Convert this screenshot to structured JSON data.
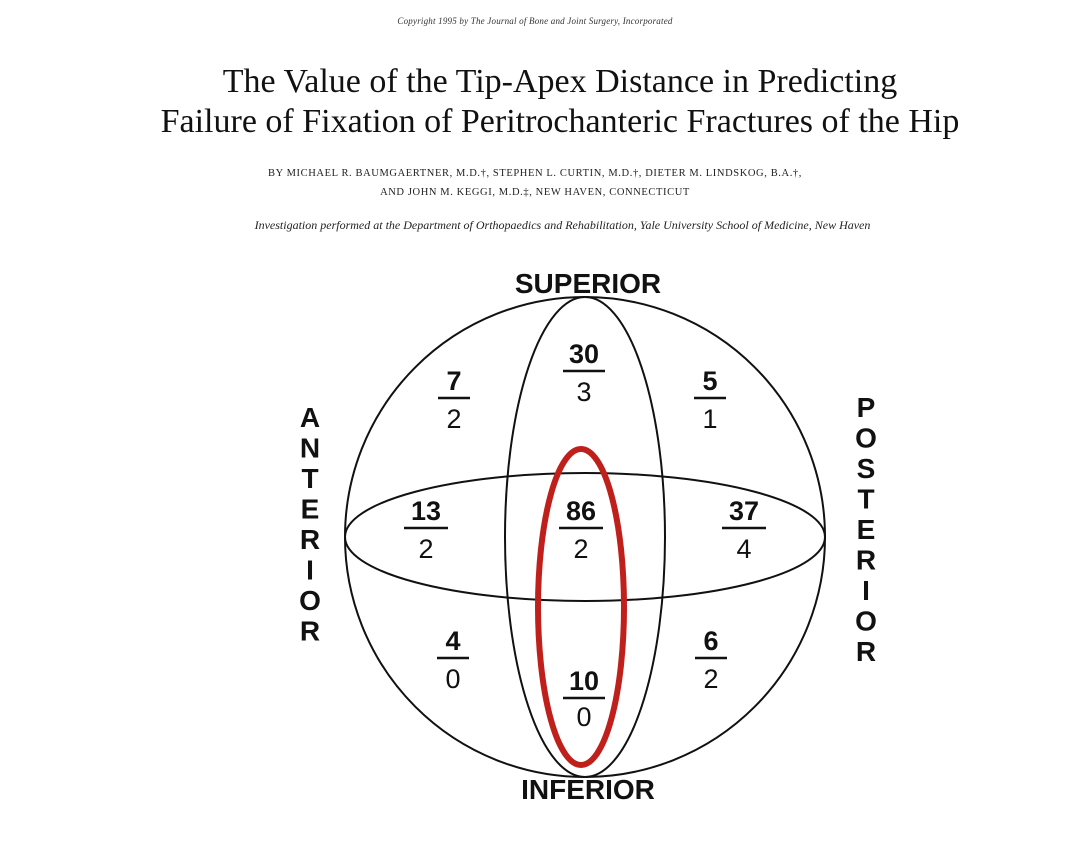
{
  "header": {
    "copyright": "Copyright 1995 by The Journal of Bone and Joint Surgery, Incorporated",
    "title_line1": "The Value of the Tip-Apex Distance in Predicting",
    "title_line2": "Failure of Fixation of Peritrochanteric Fractures of the Hip",
    "authors_line1": "BY MICHAEL R. BAUMGAERTNER, M.D.†, STEPHEN L. CURTIN, M.D.†, DIETER M. LINDSKOG, B.A.†,",
    "authors_line2": "AND JOHN M. KEGGI, M.D.‡, NEW HAVEN, CONNECTICUT",
    "investigation": "Investigation performed at the Department of Orthopaedics and Rehabilitation, Yale University School of Medicine, New Haven"
  },
  "diagram": {
    "labels": {
      "superior": "SUPERIOR",
      "inferior": "INFERIOR",
      "anterior": [
        "A",
        "N",
        "T",
        "E",
        "R",
        "I",
        "O",
        "R"
      ],
      "posterior": [
        "P",
        "O",
        "S",
        "T",
        "E",
        "R",
        "I",
        "O",
        "R"
      ]
    },
    "zones": {
      "sup_ant": {
        "top": "7",
        "bottom": "2"
      },
      "sup_center": {
        "top": "30",
        "bottom": "3"
      },
      "sup_post": {
        "top": "5",
        "bottom": "1"
      },
      "mid_ant": {
        "top": "13",
        "bottom": "2"
      },
      "center": {
        "top": "86",
        "bottom": "2"
      },
      "mid_post": {
        "top": "37",
        "bottom": "4"
      },
      "inf_ant": {
        "top": "4",
        "bottom": "0"
      },
      "inf_center": {
        "top": "10",
        "bottom": "0"
      },
      "inf_post": {
        "top": "6",
        "bottom": "2"
      }
    },
    "highlight_color": "#c0201c"
  }
}
